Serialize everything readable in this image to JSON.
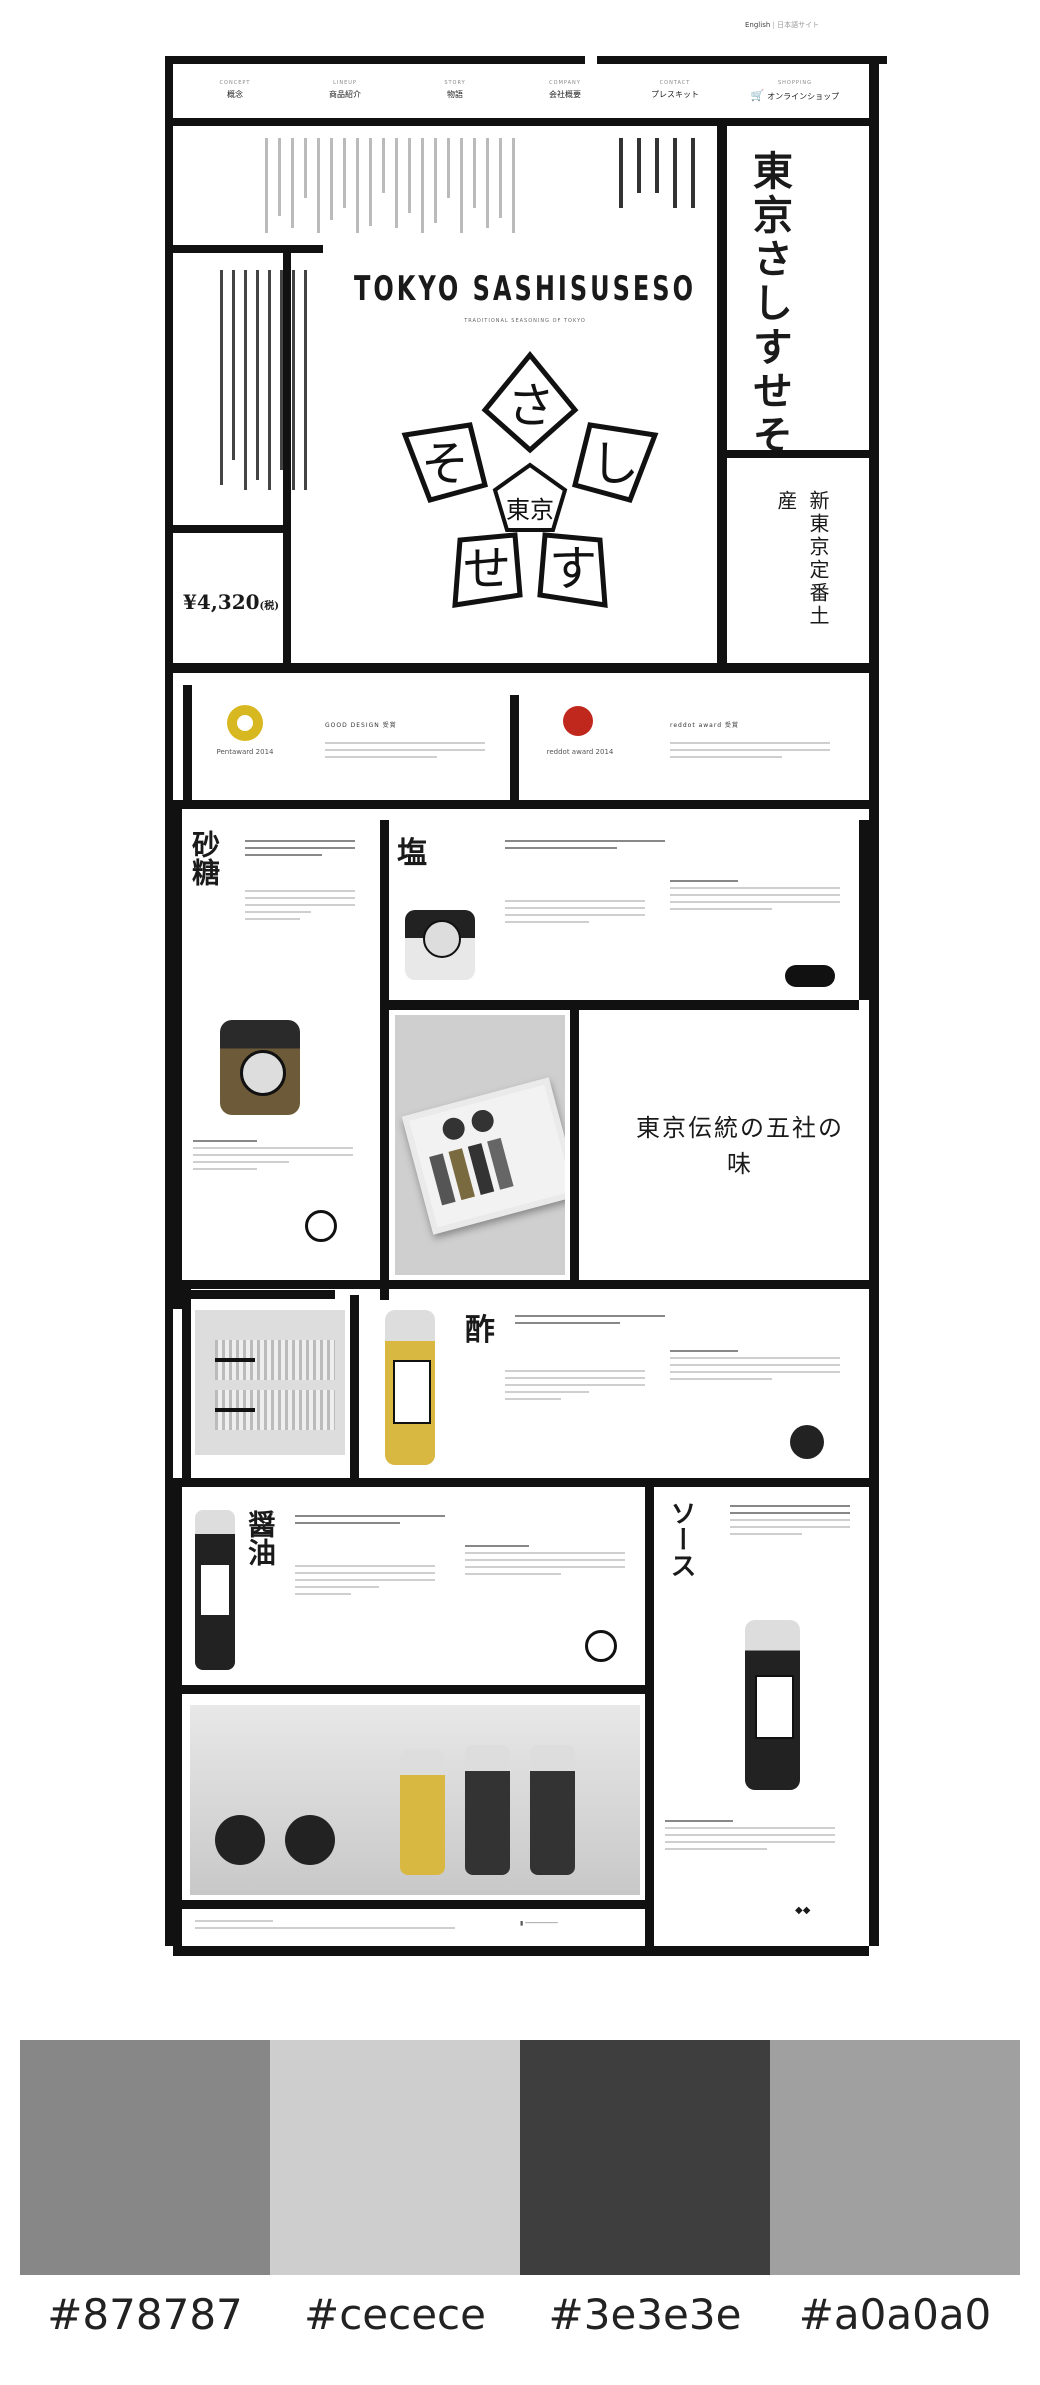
{
  "header": {
    "lang_en": "English",
    "lang_jp": "日本語サイト",
    "nav": [
      {
        "en": "CONCEPT",
        "jp": "概念"
      },
      {
        "en": "LINEUP",
        "jp": "商品紹介"
      },
      {
        "en": "STORY",
        "jp": "物語"
      },
      {
        "en": "COMPANY",
        "jp": "会社概要"
      },
      {
        "en": "CONTACT",
        "jp": "プレスキット"
      },
      {
        "en": "SHOPPING",
        "jp": "オンラインショップ"
      }
    ]
  },
  "hero": {
    "title_en": "TOKYO SASHISUSESO",
    "subtitle_en": "TRADITIONAL SEASONING OF TOKYO",
    "title_jp": "東京さしすせそ",
    "catch_jp": "新東京定番土産",
    "price": "¥4,320",
    "price_tax": "(税)",
    "logo_center": "東京",
    "logo_chars": [
      "さ",
      "し",
      "す",
      "せ",
      "そ"
    ]
  },
  "awards": [
    {
      "name": "GOOD DESIGN 受賞",
      "badge": "Pentaward 2014",
      "color": "#d8b820"
    },
    {
      "name": "reddot award 受賞",
      "badge": "reddot award 2014",
      "color": "#c0281e"
    }
  ],
  "products": {
    "sugar": {
      "kanji": "砂糖",
      "label": "砂糖"
    },
    "salt": {
      "kanji": "塩",
      "label": "塩"
    },
    "vinegar": {
      "kanji": "酢",
      "label": "酢"
    },
    "soy": {
      "kanji": "醤油",
      "label": "醤油"
    },
    "sauce": {
      "kanji": "ソース",
      "label": "ソース"
    }
  },
  "feature": {
    "text": "東京伝統の五社の味"
  },
  "palette": [
    {
      "hex": "#878787",
      "label": "#878787"
    },
    {
      "hex": "#cecece",
      "label": "#cecece"
    },
    {
      "hex": "#3e3e3e",
      "label": "#3e3e3e"
    },
    {
      "hex": "#a0a0a0",
      "label": "#a0a0a0"
    }
  ]
}
